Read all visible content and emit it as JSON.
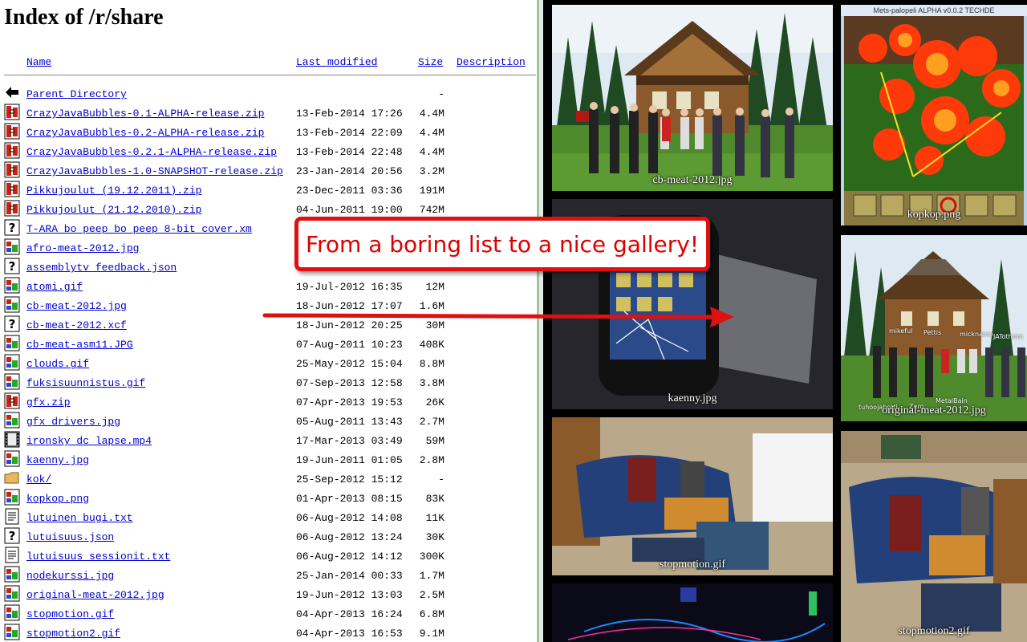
{
  "listing": {
    "title": "Index of /r/share",
    "columns": {
      "name": "Name",
      "last_modified": "Last modified",
      "size": "Size",
      "description": "Description"
    },
    "rows": [
      {
        "name": "Parent Directory",
        "date": "",
        "size": "-",
        "icon": "back-icon"
      },
      {
        "name": "CrazyJavaBubbles-0.1-ALPHA-release.zip",
        "date": "13-Feb-2014 17:26",
        "size": "4.4M",
        "icon": "compressed-icon"
      },
      {
        "name": "CrazyJavaBubbles-0.2-ALPHA-release.zip",
        "date": "13-Feb-2014 22:09",
        "size": "4.4M",
        "icon": "compressed-icon"
      },
      {
        "name": "CrazyJavaBubbles-0.2.1-ALPHA-release.zip",
        "date": "13-Feb-2014 22:48",
        "size": "4.4M",
        "icon": "compressed-icon"
      },
      {
        "name": "CrazyJavaBubbles-1.0-SNAPSHOT-release.zip",
        "date": "23-Jan-2014 20:56",
        "size": "3.2M",
        "icon": "compressed-icon"
      },
      {
        "name": "Pikkujoulut (19.12.2011).zip",
        "date": "23-Dec-2011 03:36",
        "size": "191M",
        "icon": "compressed-icon"
      },
      {
        "name": "Pikkujoulut (21.12.2010).zip",
        "date": "04-Jun-2011 19:00",
        "size": "742M",
        "icon": "compressed-icon"
      },
      {
        "name": "T-ARA_bo_peep_bo_peep_8-bit_cover.xm",
        "date": "",
        "size": "",
        "icon": "unknown-icon"
      },
      {
        "name": "afro-meat-2012.jpg",
        "date": "",
        "size": "",
        "icon": "image-icon"
      },
      {
        "name": "assemblytv_feedback.json",
        "date": "",
        "size": "",
        "icon": "unknown-icon"
      },
      {
        "name": "atomi.gif",
        "date": "19-Jul-2012 16:35",
        "size": "12M",
        "icon": "image-icon"
      },
      {
        "name": "cb-meat-2012.jpg",
        "date": "18-Jun-2012 17:07",
        "size": "1.6M",
        "icon": "image-icon"
      },
      {
        "name": "cb-meat-2012.xcf",
        "date": "18-Jun-2012 20:25",
        "size": "30M",
        "icon": "unknown-icon"
      },
      {
        "name": "cb-meat-asm11.JPG",
        "date": "07-Aug-2011 10:23",
        "size": "408K",
        "icon": "image-icon"
      },
      {
        "name": "clouds.gif",
        "date": "25-May-2012 15:04",
        "size": "8.8M",
        "icon": "image-icon"
      },
      {
        "name": "fuksisuunnistus.gif",
        "date": "07-Sep-2013 12:58",
        "size": "3.8M",
        "icon": "image-icon"
      },
      {
        "name": "gfx.zip",
        "date": "07-Apr-2013 19:53",
        "size": "26K",
        "icon": "compressed-icon"
      },
      {
        "name": "gfx_drivers.jpg",
        "date": "05-Aug-2011 13:43",
        "size": "2.7M",
        "icon": "image-icon"
      },
      {
        "name": "ironsky_dc_lapse.mp4",
        "date": "17-Mar-2013 03:49",
        "size": "59M",
        "icon": "movie-icon"
      },
      {
        "name": "kaenny.jpg",
        "date": "19-Jun-2011 01:05",
        "size": "2.8M",
        "icon": "image-icon"
      },
      {
        "name": "kok/",
        "date": "25-Sep-2012 15:12",
        "size": "-",
        "icon": "folder-icon"
      },
      {
        "name": "kopkop.png",
        "date": "01-Apr-2013 08:15",
        "size": "83K",
        "icon": "image-icon"
      },
      {
        "name": "lutuinen_bugi.txt",
        "date": "06-Aug-2012 14:08",
        "size": "11K",
        "icon": "text-icon"
      },
      {
        "name": "lutuisuus.json",
        "date": "06-Aug-2012 13:24",
        "size": "30K",
        "icon": "unknown-icon"
      },
      {
        "name": "lutuisuus_sessionit.txt",
        "date": "06-Aug-2012 14:12",
        "size": "300K",
        "icon": "text-icon"
      },
      {
        "name": "nodekurssi.jpg",
        "date": "25-Jan-2014 00:33",
        "size": "1.7M",
        "icon": "image-icon"
      },
      {
        "name": "original-meat-2012.jpg",
        "date": "19-Jun-2012 13:03",
        "size": "2.5M",
        "icon": "image-icon"
      },
      {
        "name": "stopmotion.gif",
        "date": "04-Apr-2013 16:24",
        "size": "6.8M",
        "icon": "image-icon"
      },
      {
        "name": "stopmotion2.gif",
        "date": "04-Apr-2013 16:53",
        "size": "9.1M",
        "icon": "image-icon"
      }
    ]
  },
  "gallery": {
    "tiles": [
      {
        "caption": "cb-meat-2012.jpg",
        "kind": "house"
      },
      {
        "caption": "kopkop.png",
        "kind": "game",
        "window_title": "Mets-palopeli ALPHA v0.0.2 TECHDE"
      },
      {
        "caption": "kaenny.jpg",
        "kind": "phone"
      },
      {
        "caption": "original-meat-2012.jpg",
        "kind": "house2",
        "labels": [
          "mikeful",
          "Pettis",
          "mickname",
          "JATothrim",
          "tuhoojabotti",
          "Zero",
          "MetalBain"
        ]
      },
      {
        "caption": "stopmotion.gif",
        "kind": "room"
      },
      {
        "caption": "stopmotion2.gif",
        "kind": "room2"
      },
      {
        "caption": "",
        "kind": "dark"
      }
    ]
  },
  "annotation": {
    "callout_text": "From a boring list to a nice gallery!",
    "color": "#e01010"
  },
  "colors": {
    "link": "#0000cc",
    "divider": "#9fc6a4"
  }
}
